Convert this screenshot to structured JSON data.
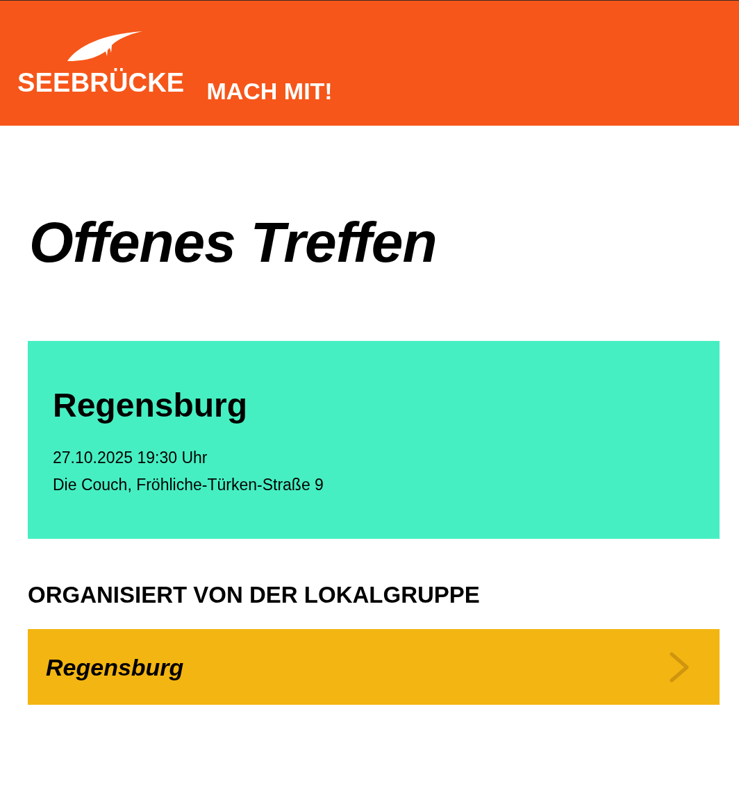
{
  "header": {
    "logo_text": "SEEBRÜCKE",
    "nav_link": "MACH MIT!"
  },
  "title": "Offenes Treffen",
  "event_card": {
    "city": "Regensburg",
    "datetime": "27.10.2025 19:30 Uhr",
    "location": "Die Couch, Fröhliche-Türken-Straße 9"
  },
  "organizer": {
    "heading": "ORGANISIERT VON DER LOKALGRUPPE",
    "group_link": "Regensburg"
  }
}
